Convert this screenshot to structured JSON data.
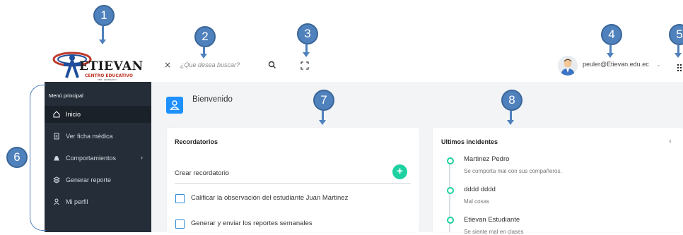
{
  "header": {
    "brand": "ETIEVAN",
    "brand_sub": "CENTRO EDUCATIVO",
    "brand_sub2": "FEM · RUMIÑAHUI",
    "close_glyph": "×",
    "search_placeholder": "¿Que desea buscar?",
    "user_email": "peuler@Etievan.edu.ec",
    "user_caret": "⌄"
  },
  "callouts": [
    "1",
    "2",
    "3",
    "4",
    "5",
    "6",
    "7",
    "8"
  ],
  "sidebar": {
    "title": "Menú principal",
    "items": [
      {
        "label": "Inicio",
        "icon": "home-icon",
        "active": true
      },
      {
        "label": "Ver ficha médica",
        "icon": "clipboard-icon",
        "active": false
      },
      {
        "label": "Comportamientos",
        "icon": "bell-icon",
        "active": false,
        "chevron": "›"
      },
      {
        "label": "Generar reporte",
        "icon": "layers-icon",
        "active": false
      },
      {
        "label": "Mi perfil",
        "icon": "user-icon",
        "active": false
      }
    ]
  },
  "main": {
    "welcome": "Bienvenido",
    "reminders": {
      "title": "Recordatorios",
      "new_label": "Crear recordatorio",
      "add_glyph": "+",
      "items": [
        "Calificar la observación del estudiante Juan Martinez",
        "Generar y enviar los reportes semanales"
      ]
    },
    "incidents": {
      "title": "Ultimos incidentes",
      "back_glyph": "‹",
      "items": [
        {
          "name": "Martinez Pedro",
          "desc": "Se comporta mal con sus compañeros."
        },
        {
          "name": "dddd dddd",
          "desc": "Mal cosas"
        },
        {
          "name": "Etievan Estudiante",
          "desc": "Se siente mal en clases"
        }
      ]
    }
  },
  "colors": {
    "callout": "#4f81bd",
    "sidebar": "#252d38",
    "accent_blue": "#1e90ff",
    "accent_green": "#1dd1a1"
  }
}
